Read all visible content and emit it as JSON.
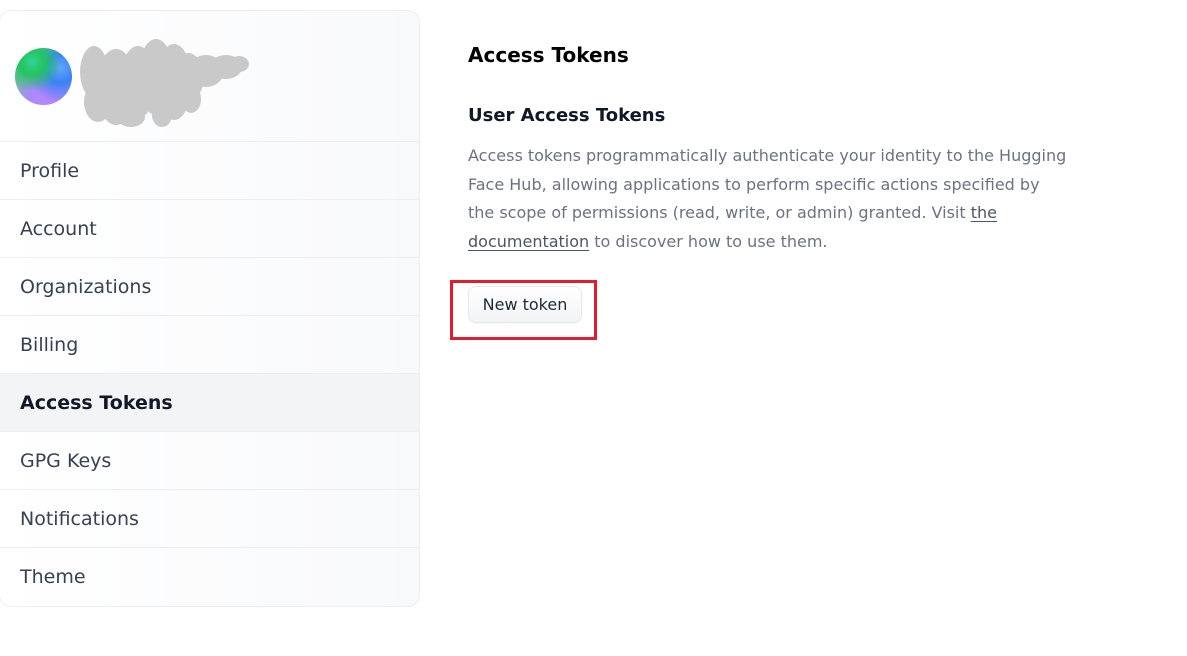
{
  "sidebar": {
    "items": [
      {
        "label": "Profile"
      },
      {
        "label": "Account"
      },
      {
        "label": "Organizations"
      },
      {
        "label": "Billing"
      },
      {
        "label": "Access Tokens"
      },
      {
        "label": "GPG Keys"
      },
      {
        "label": "Notifications"
      },
      {
        "label": "Theme"
      }
    ],
    "active_item": "Access Tokens"
  },
  "main": {
    "title": "Access Tokens",
    "section_title": "User Access Tokens",
    "description_text": "Access tokens programmatically authenticate your identity to the Hugging Face Hub, allowing applications to perform specific actions specified by the scope of permissions (read, write, or admin) granted. Visit ",
    "description_link": "the documentation",
    "description_suffix": " to discover how to use them.",
    "new_token_button": "New token"
  },
  "colors": {
    "highlight_box": "#e11d2e",
    "active_nav_bg": "#f3f4f6"
  }
}
